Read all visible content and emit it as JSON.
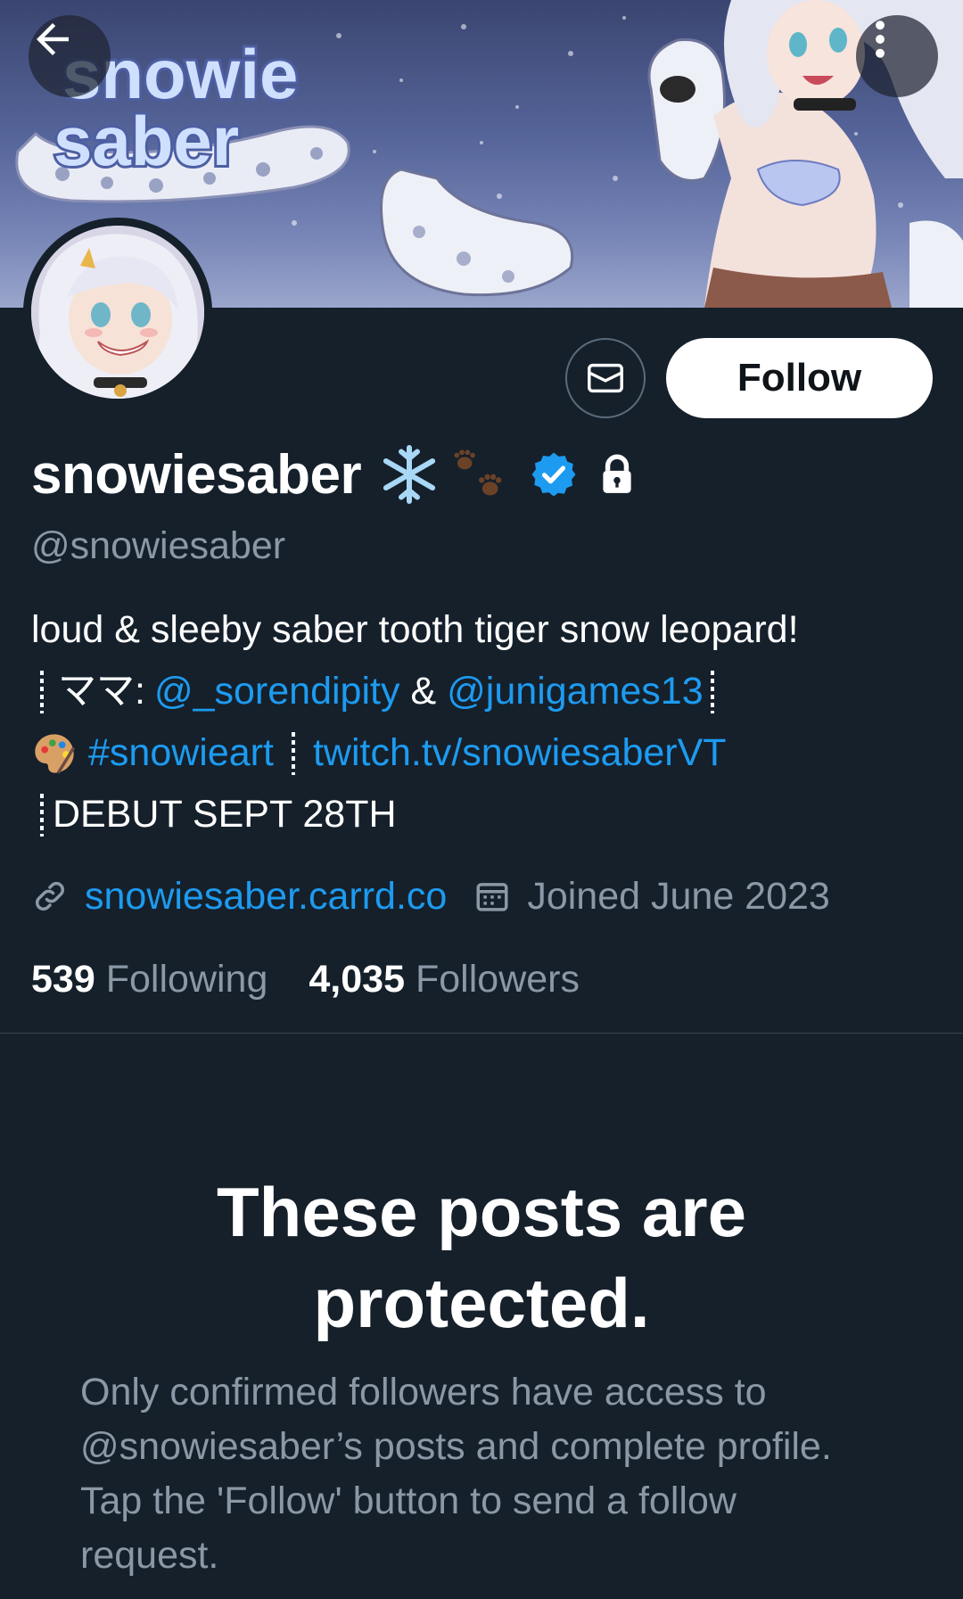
{
  "header": {
    "back_icon": "arrow-left-icon",
    "more_icon": "more-vertical-icon",
    "banner_logo_text": "snowie saber"
  },
  "actions": {
    "message_icon": "envelope-icon",
    "follow_label": "Follow"
  },
  "profile": {
    "display_name": "snowiesaber",
    "name_emojis": [
      "❄️",
      "🐾"
    ],
    "verified_icon": "verified-badge-icon",
    "protected_icon": "lock-icon",
    "handle": "@snowiesaber"
  },
  "bio": {
    "line1": "loud & sleeby saber tooth tiger snow leopard!",
    "line2_prefix": "ママ:",
    "mention1": "@_sorendipity",
    "ampersand": "&",
    "mention2": "@junigames13",
    "palette_emoji": "🎨",
    "hashtag": "#snowieart",
    "twitch_link": "twitch.tv/snowiesaberVT",
    "line4": "DEBUT SEPT 28TH"
  },
  "meta": {
    "link_icon": "link-icon",
    "website": "snowiesaber.carrd.co",
    "calendar_icon": "calendar-icon",
    "joined": "Joined June 2023"
  },
  "stats": {
    "following_count": "539",
    "following_label": "Following",
    "followers_count": "4,035",
    "followers_label": "Followers"
  },
  "protected": {
    "title": "These posts are protected.",
    "body": "Only confirmed followers have access to @snowiesaber’s posts and complete profile. Tap the 'Follow' button to send a follow request."
  },
  "colors": {
    "background": "#15202b",
    "accent": "#1d9bf0",
    "secondary_text": "#8b98a5",
    "divider": "#38444d",
    "follow_button_bg": "#ffffff"
  }
}
